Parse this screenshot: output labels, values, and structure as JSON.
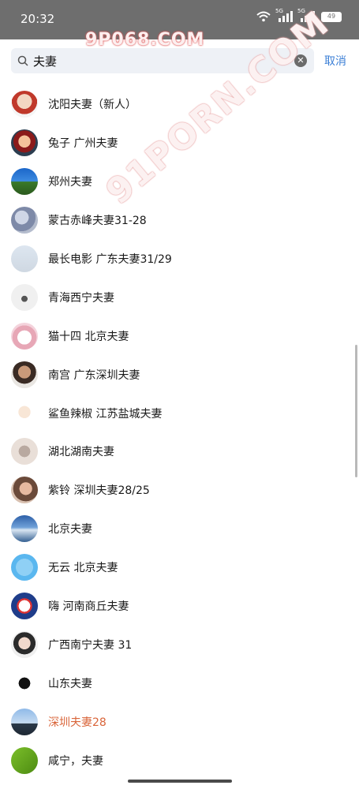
{
  "status_bar": {
    "time": "20:32",
    "battery": "49",
    "signal_label_1": "5G",
    "signal_label_2": "5G"
  },
  "watermarks": {
    "top": "9P068.COM",
    "diagonal": "91PORN.COM"
  },
  "search": {
    "value": "夫妻",
    "cancel_label": "取消",
    "icon": "search-icon",
    "clear_icon": "close-circle-icon"
  },
  "results": [
    {
      "name": "沈阳夫妻（新人）",
      "highlight": false
    },
    {
      "name": "兔子 广州夫妻",
      "highlight": false
    },
    {
      "name": "郑州夫妻",
      "highlight": false
    },
    {
      "name": "蒙古赤峰夫妻31-28",
      "highlight": false
    },
    {
      "name": "最长电影  广东夫妻31/29",
      "highlight": false
    },
    {
      "name": "青海西宁夫妻",
      "highlight": false
    },
    {
      "name": "猫十四 北京夫妻",
      "highlight": false
    },
    {
      "name": "南宫  广东深圳夫妻",
      "highlight": false
    },
    {
      "name": "鲨鱼辣椒 江苏盐城夫妻",
      "highlight": false
    },
    {
      "name": "湖北湖南夫妻",
      "highlight": false
    },
    {
      "name": "紫铃 深圳夫妻28/25",
      "highlight": false
    },
    {
      "name": "北京夫妻",
      "highlight": false
    },
    {
      "name": "无云 北京夫妻",
      "highlight": false
    },
    {
      "name": "嗨 河南商丘夫妻",
      "highlight": false
    },
    {
      "name": "广西南宁夫妻 31",
      "highlight": false
    },
    {
      "name": "山东夫妻",
      "highlight": false
    },
    {
      "name": "深圳夫妻28",
      "highlight": true
    },
    {
      "name": "咸宁，夫妻",
      "highlight": false
    }
  ],
  "colors": {
    "status_bar_bg": "#6e6e6e",
    "accent": "#3b7fd6",
    "highlight_name": "#d9653a"
  }
}
